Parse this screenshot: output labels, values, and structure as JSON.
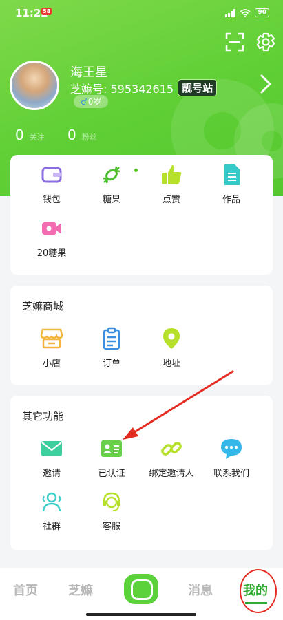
{
  "status_bar": {
    "time": "11:22",
    "notification_badge": "58",
    "battery": "90"
  },
  "profile": {
    "nickname": "海王星",
    "id_label": "芝嫲号: 595342615",
    "vip_tag": "靓号站",
    "gender_icon": "♂",
    "age": "0岁"
  },
  "stats": [
    {
      "value": "0",
      "label": "关注"
    },
    {
      "value": "0",
      "label": "粉丝"
    }
  ],
  "assets": [
    {
      "label": "钱包",
      "icon": "wallet-icon"
    },
    {
      "label": "糖果",
      "icon": "candy-icon"
    },
    {
      "label": "点赞",
      "icon": "thumbs-up-icon"
    },
    {
      "label": "作品",
      "icon": "document-icon"
    },
    {
      "label": "20糖果",
      "icon": "video-camera-icon"
    }
  ],
  "mall": {
    "title": "芝嫲商城",
    "items": [
      {
        "label": "小店",
        "icon": "shop-icon"
      },
      {
        "label": "订单",
        "icon": "clipboard-icon"
      },
      {
        "label": "地址",
        "icon": "location-pin-icon"
      }
    ]
  },
  "other": {
    "title": "其它功能",
    "items": [
      {
        "label": "邀请",
        "icon": "mail-icon"
      },
      {
        "label": "已认证",
        "icon": "id-card-icon"
      },
      {
        "label": "绑定邀请人",
        "icon": "link-icon"
      },
      {
        "label": "联系我们",
        "icon": "chat-bubble-icon"
      },
      {
        "label": "社群",
        "icon": "people-icon"
      },
      {
        "label": "客服",
        "icon": "customer-service-icon"
      }
    ]
  },
  "tabs": [
    {
      "label": "首页",
      "active": false
    },
    {
      "label": "芝嫲",
      "active": false
    },
    {
      "label": "消息",
      "active": false
    },
    {
      "label": "我的",
      "active": true
    }
  ],
  "colors": {
    "brand_green": "#5fcf35",
    "active_tab": "#2da831",
    "annotation_red": "#e42b21"
  }
}
